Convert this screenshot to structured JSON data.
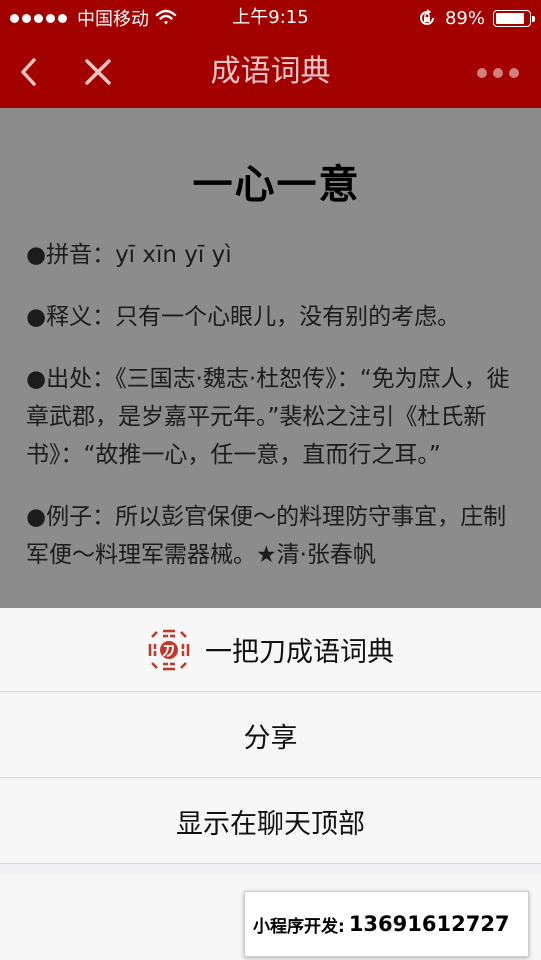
{
  "status_bar": {
    "carrier": "中国移动",
    "time": "上午9:15",
    "battery": "89%",
    "battery_level": 0.89
  },
  "nav": {
    "title": "成语词典",
    "back_icon": "chevron-left-icon",
    "close_icon": "close-icon",
    "more_icon": "more-dots-icon"
  },
  "idiom": {
    "title": "一心一意",
    "pinyin": "●拼音：yī xīn yī yì",
    "meaning": "●释义：只有一个心眼儿，没有别的考虑。",
    "source": "●出处：《三国志·魏志·杜恕传》：“免为庶人，徙章武郡，是岁嘉平元年。”裴松之注引《杜氏新书》：“故推一心，任一意，直而行之耳。”",
    "example": "●例子：所以彭官保便～的料理防守事宜，庄制军便～料理军需器械。★清·张春帆"
  },
  "action_sheet": {
    "app_name": "一把刀成语词典",
    "app_logo_icon": "bagua-logo-icon",
    "share": "分享",
    "pin_to_chat": "显示在聊天顶部"
  },
  "promo": {
    "label": "小程序开发:",
    "phone": "13691612727"
  },
  "colors": {
    "brand": "#a30000",
    "overlay": "rgba(0,0,0,0.45)"
  }
}
